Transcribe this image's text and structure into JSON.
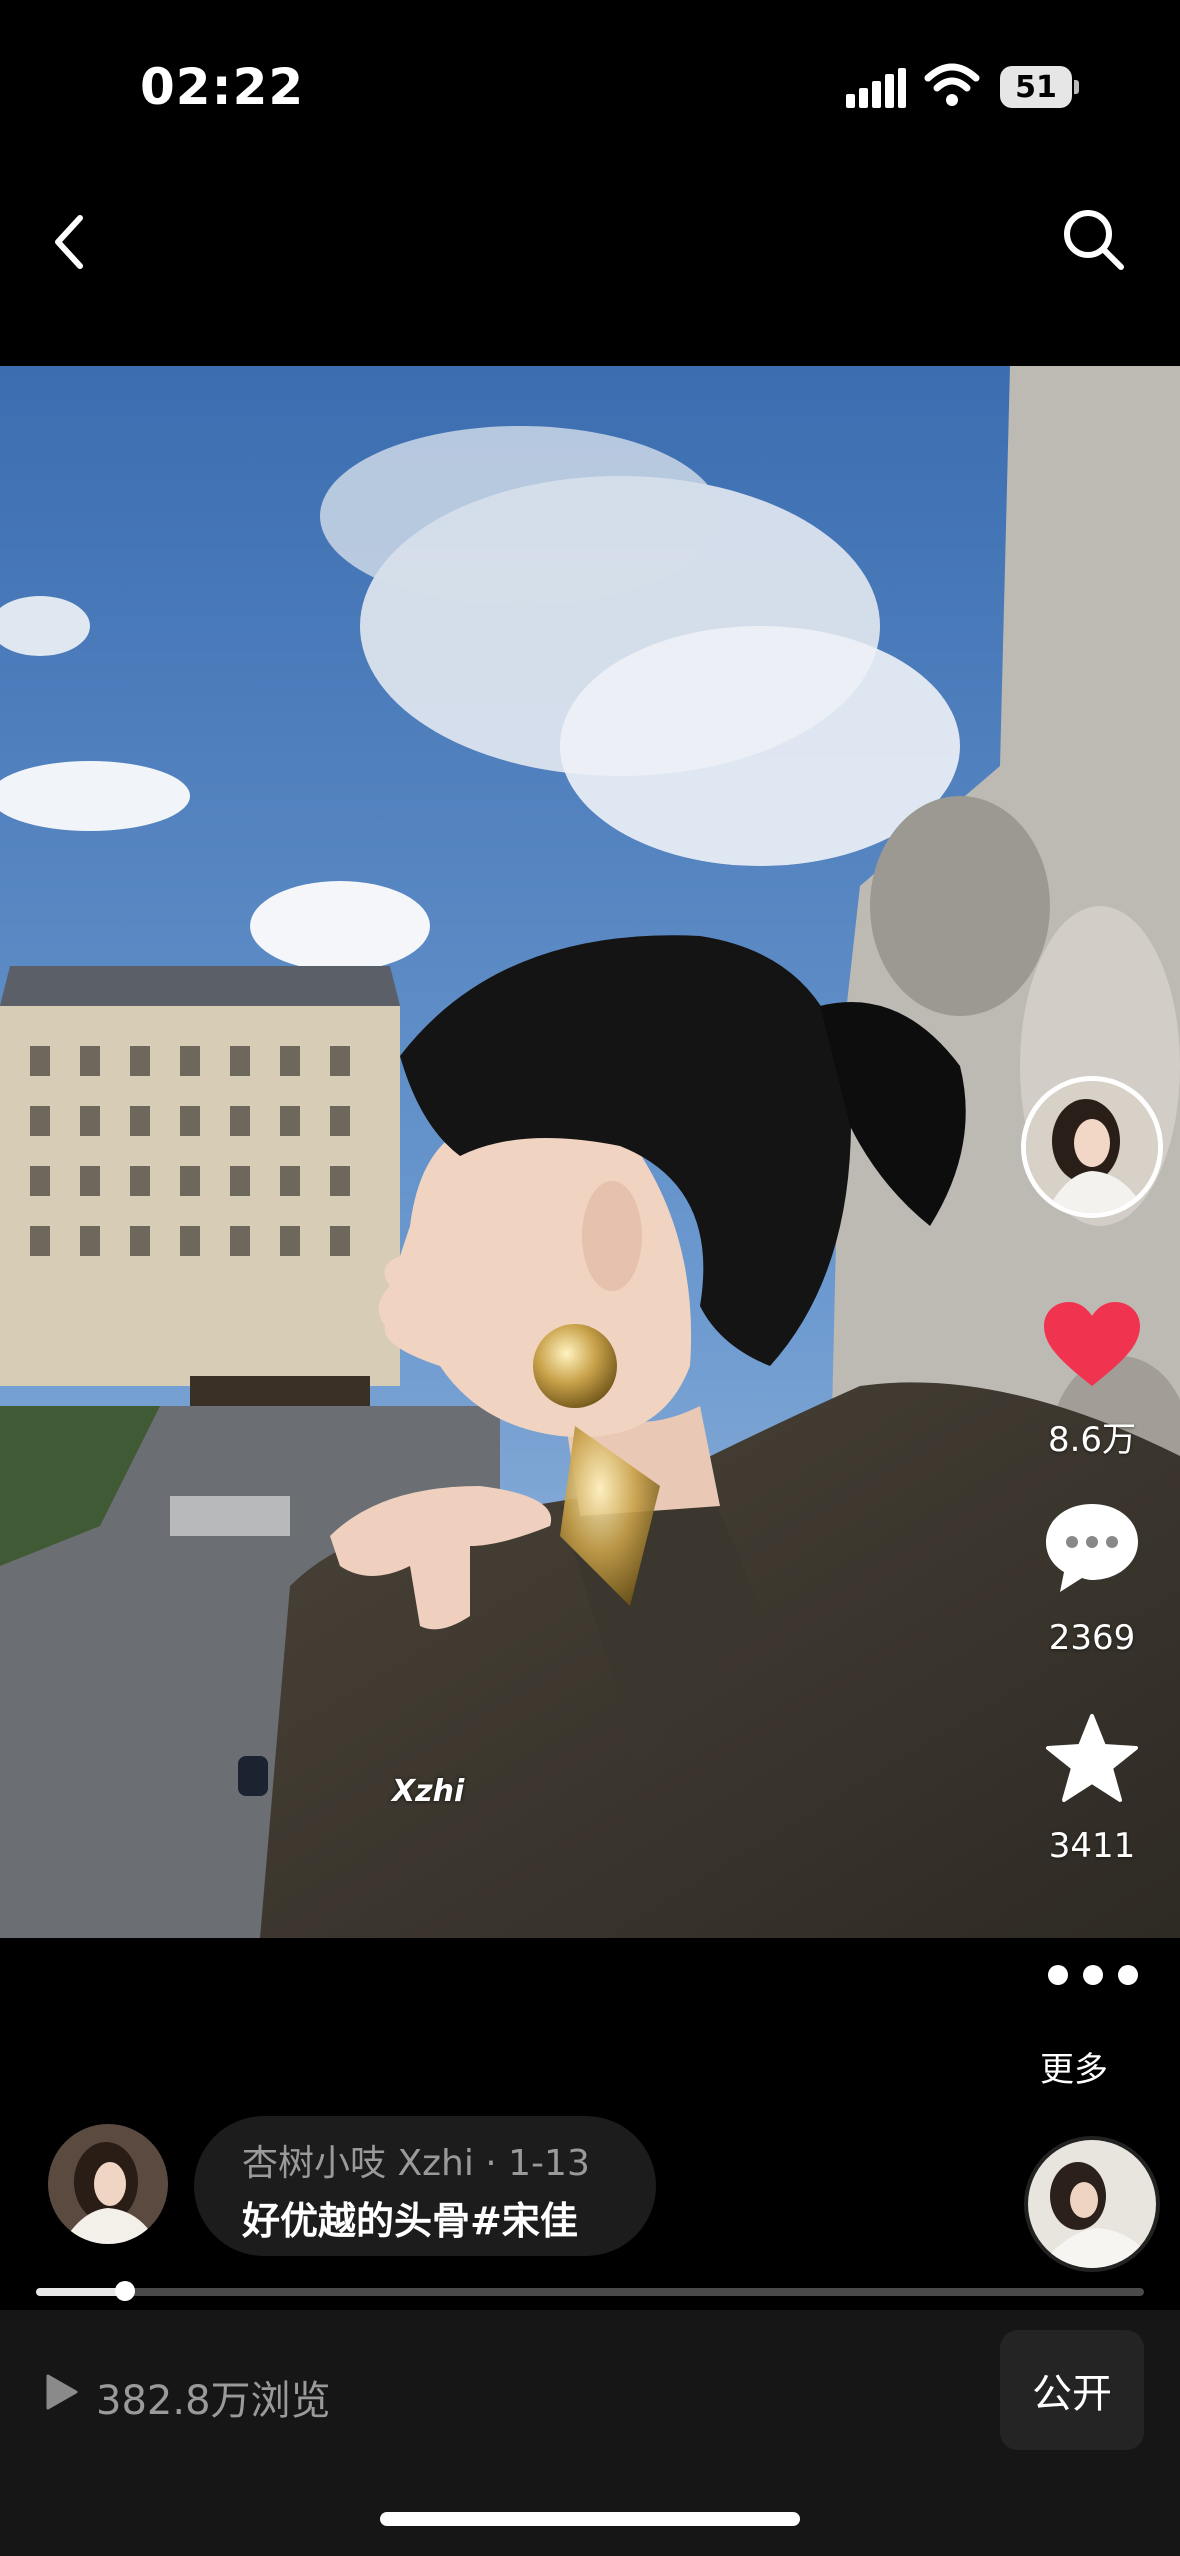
{
  "status_bar": {
    "time": "02:22",
    "battery": "51"
  },
  "nav": {
    "back_icon": "chevron-left-icon",
    "search_icon": "search-icon"
  },
  "video": {
    "watermark": "Xzhi"
  },
  "actions": {
    "likes": "8.6万",
    "comments": "2369",
    "favorites": "3411",
    "more_label": "更多",
    "like_color": "#f0334f"
  },
  "caption": {
    "meta": "杏树小吱 Xzhi · 1-13",
    "text": "好优越的头骨#宋佳"
  },
  "progress": {
    "fraction": 0.08
  },
  "bottom_bar": {
    "views": "382.8万浏览",
    "public_label": "公开"
  }
}
